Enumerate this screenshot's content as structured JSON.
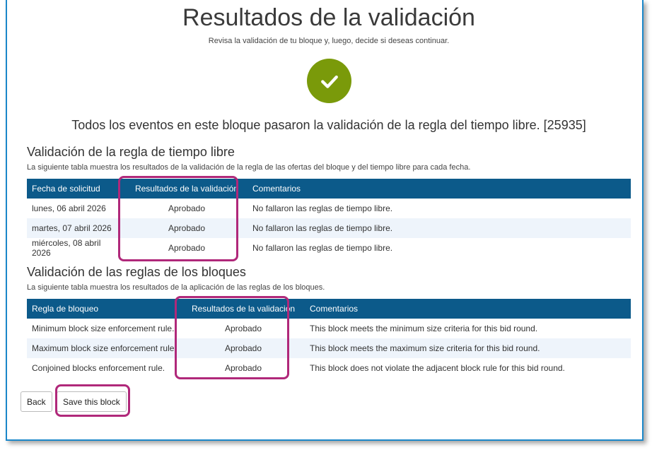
{
  "page": {
    "title": "Resultados de la validación",
    "subtitle": "Revisa la validación de tu bloque y, luego, decide si deseas continuar.",
    "message": "Todos los eventos en este bloque pasaron la validación de la regla del tiempo libre. [25935]",
    "status_icon": "checkmark-icon",
    "status_color": "#7a9a0a"
  },
  "section1": {
    "title": "Validación de la regla de tiempo libre",
    "desc": "La siguiente tabla muestra los resultados de la validación de la regla de las ofertas del bloque y del tiempo libre para cada fecha.",
    "headers": [
      "Fecha de solicitud",
      "Resultados de la validación",
      "Comentarios"
    ],
    "rows": [
      [
        "lunes, 06 abril 2026",
        "Aprobado",
        "No fallaron las reglas de tiempo libre."
      ],
      [
        "martes, 07 abril 2026",
        "Aprobado",
        "No fallaron las reglas de tiempo libre."
      ],
      [
        "miércoles, 08 abril 2026",
        "Aprobado",
        "No fallaron las reglas de tiempo libre."
      ]
    ]
  },
  "section2": {
    "title": "Validación de las reglas de los bloques",
    "desc": "La siguiente tabla muestra los resultados de la aplicación de las reglas de los bloques.",
    "headers": [
      "Regla de bloqueo",
      "Resultados de la validación",
      "Comentarios"
    ],
    "rows": [
      [
        "Minimum block size enforcement rule.",
        "Aprobado",
        "This block meets the minimum size criteria for this bid round."
      ],
      [
        "Maximum block size enforcement rule.",
        "Aprobado",
        "This block meets the maximum size criteria for this bid round."
      ],
      [
        "Conjoined blocks enforcement rule.",
        "Aprobado",
        "This block does not violate the adjacent block rule for this bid round."
      ]
    ]
  },
  "buttons": {
    "back": "Back",
    "save": "Save this block"
  },
  "colors": {
    "header": "#0c5a8a",
    "approved": "#6a9a15",
    "highlight": "#b0287a",
    "frame": "#1b87c9"
  }
}
